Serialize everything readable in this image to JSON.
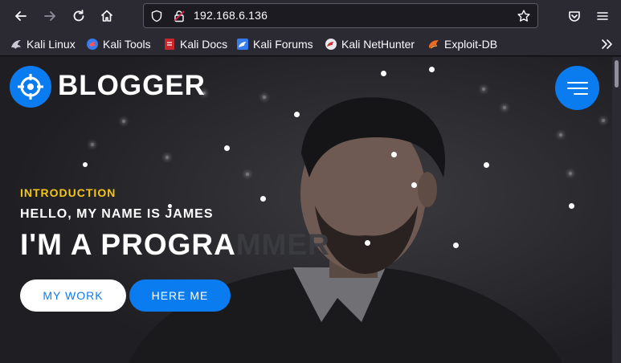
{
  "browser": {
    "url": "192.168.6.136",
    "bookmarks": [
      {
        "label": "Kali Linux",
        "icon": "kali-dragon-icon"
      },
      {
        "label": "Kali Tools",
        "icon": "kali-tools-icon"
      },
      {
        "label": "Kali Docs",
        "icon": "kali-docs-icon"
      },
      {
        "label": "Kali Forums",
        "icon": "kali-forums-icon"
      },
      {
        "label": "Kali NetHunter",
        "icon": "kali-nethunter-icon"
      },
      {
        "label": "Exploit-DB",
        "icon": "exploit-db-icon"
      }
    ]
  },
  "site": {
    "brand": "BLOGGER",
    "intro_label": "INTRODUCTION",
    "greeting": "HELLO, MY NAME IS JAMES",
    "headline_visible": "I'M A PROGRA",
    "headline_faded": "MMER",
    "buttons": {
      "work": "MY WORK",
      "hire": "HERE ME"
    }
  },
  "colors": {
    "accent": "#0a7cf0",
    "intro": "#f5c518",
    "chrome": "#2b2a33"
  }
}
